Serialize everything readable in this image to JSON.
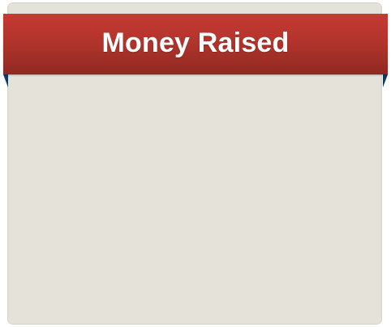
{
  "banner": {
    "title": "Money Raised"
  },
  "colors": {
    "panel_background": "#e5e2da",
    "banner_top": "#c63a33",
    "banner_bottom": "#8f2a22",
    "ribbon_fold": "#0f3b68",
    "title_text": "#ffffff"
  }
}
